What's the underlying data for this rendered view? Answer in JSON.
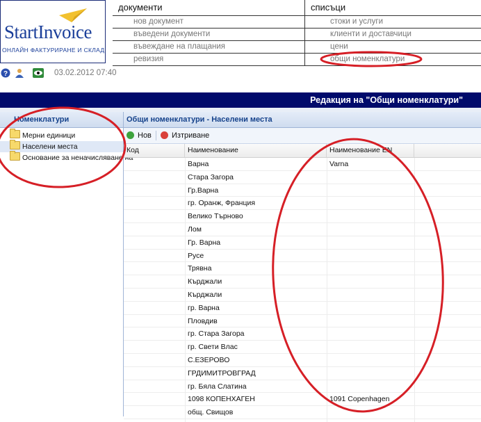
{
  "logo": {
    "brand": "StartInvoice",
    "tagline": "ОНЛАЙН ФАКТУРИРАНЕ И СКЛАД",
    "colors": {
      "brand": "#1b3f9a",
      "plane": "#f2c12e"
    }
  },
  "menu": {
    "documents": {
      "header": "документи",
      "items": [
        "нов документ",
        "въведени документи",
        "въвеждане на плащания",
        "ревизия"
      ]
    },
    "lists": {
      "header": "списъци",
      "items": [
        "стоки и услуги",
        "клиенти и доставчици",
        "цени",
        "общи номенклатури"
      ]
    }
  },
  "toolbar": {
    "icons": [
      "help-icon",
      "user-icon",
      "eye-icon"
    ],
    "datetime": "03.02.2012 07:40"
  },
  "title_bar": {
    "text": "Редакция на \"Общи номенклатури\"",
    "color": "#000a6b"
  },
  "left_panel": {
    "title": "Номенклатури",
    "items": [
      {
        "label": "Мерни единици",
        "selected": false
      },
      {
        "label": "Населени места",
        "selected": true
      },
      {
        "label": "Основание за неначисляване на",
        "selected": false
      }
    ]
  },
  "main_panel": {
    "title": "Общи номенклатури - Населени места",
    "buttons": {
      "new": "Нов",
      "delete": "Изтриване"
    },
    "columns": {
      "code": "Код",
      "name": "Наименование",
      "name_en": "Наименование EN"
    },
    "rows": [
      {
        "code": "",
        "name": "Варна",
        "name_en": "Varna"
      },
      {
        "code": "",
        "name": "Стара Загора",
        "name_en": ""
      },
      {
        "code": "",
        "name": "Гр.Варна",
        "name_en": ""
      },
      {
        "code": "",
        "name": "гр. Оранж, Франция",
        "name_en": ""
      },
      {
        "code": "",
        "name": "Велико Търново",
        "name_en": ""
      },
      {
        "code": "",
        "name": "Лом",
        "name_en": ""
      },
      {
        "code": "",
        "name": "Гр. Варна",
        "name_en": ""
      },
      {
        "code": "",
        "name": "Русе",
        "name_en": ""
      },
      {
        "code": "",
        "name": "Трявна",
        "name_en": ""
      },
      {
        "code": "",
        "name": "Кърджали",
        "name_en": ""
      },
      {
        "code": "",
        "name": "Кърджали",
        "name_en": ""
      },
      {
        "code": "",
        "name": "гр. Варна",
        "name_en": ""
      },
      {
        "code": "",
        "name": "Пловдив",
        "name_en": ""
      },
      {
        "code": "",
        "name": "гр. Стара Загора",
        "name_en": ""
      },
      {
        "code": "",
        "name": "гр. Свети Влас",
        "name_en": ""
      },
      {
        "code": "",
        "name": "С.ЕЗЕРОВО",
        "name_en": ""
      },
      {
        "code": "",
        "name": "ГРДИМИТРОВГРАД",
        "name_en": ""
      },
      {
        "code": "",
        "name": "гр. Бяла Слатина",
        "name_en": ""
      },
      {
        "code": "",
        "name": "1098 КОПЕНХАГЕН",
        "name_en": "1091 Copenhagen"
      },
      {
        "code": "",
        "name": "общ. Свищов",
        "name_en": ""
      }
    ]
  },
  "annotation_color": "#d61f26"
}
